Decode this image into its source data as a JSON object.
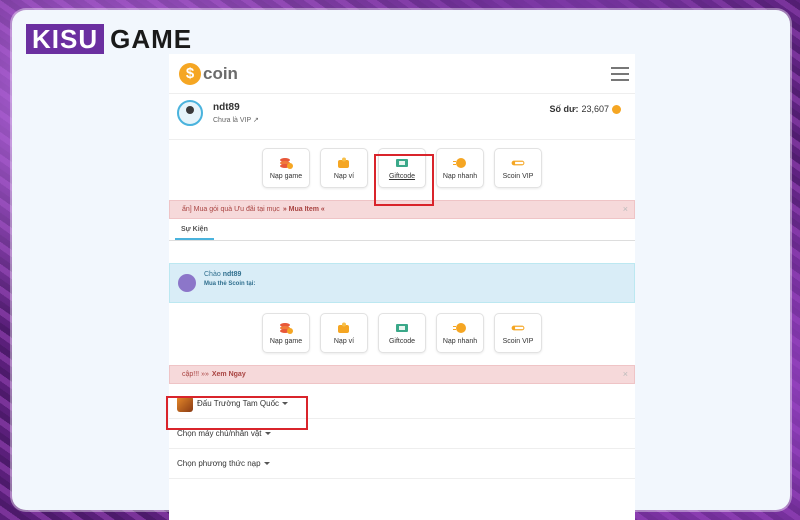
{
  "brand": {
    "part1": "KISU",
    "part2": "GAME"
  },
  "app": {
    "logo_symbol": "$",
    "logo_text": "coin"
  },
  "user": {
    "name": "ndt89",
    "vip_status": "Chưa là VIP",
    "balance_label": "Số dư:",
    "balance_value": "23,607"
  },
  "actions": [
    {
      "label": "Nạp game",
      "icon": "coins-stack-icon",
      "color": "#e8583a"
    },
    {
      "label": "Nạp ví",
      "icon": "wallet-icon",
      "color": "#f5a623"
    },
    {
      "label": "Giftcode",
      "icon": "gift-card-icon",
      "color": "#3aa889"
    },
    {
      "label": "Nạp nhanh",
      "icon": "fast-coin-icon",
      "color": "#f5a623"
    },
    {
      "label": "Scoin VIP",
      "icon": "vip-coin-icon",
      "color": "#f5a623"
    }
  ],
  "alert1": {
    "text": "ẩn] Mua gói quà Ưu đãi tại mục",
    "link": "» Mua Item «",
    "close": "×"
  },
  "tab": {
    "label": "Sự Kiện"
  },
  "hello": {
    "greeting": "Chào",
    "name": "ndt89",
    "sub": "Mua thẻ Scoin tại:"
  },
  "actions2": [
    {
      "label": "Nạp game"
    },
    {
      "label": "Nạp ví"
    },
    {
      "label": "Giftcode"
    },
    {
      "label": "Nạp nhanh"
    },
    {
      "label": "Scoin VIP"
    }
  ],
  "alert2": {
    "text": "cập!!! »»",
    "link": "Xem Ngay",
    "close": "×"
  },
  "game_select": {
    "value": "Đấu Trường Tam Quốc"
  },
  "server_select": {
    "value": "Chọn máy chủ/nhân vật"
  },
  "method_select": {
    "value": "Chọn phương thức nạp"
  }
}
